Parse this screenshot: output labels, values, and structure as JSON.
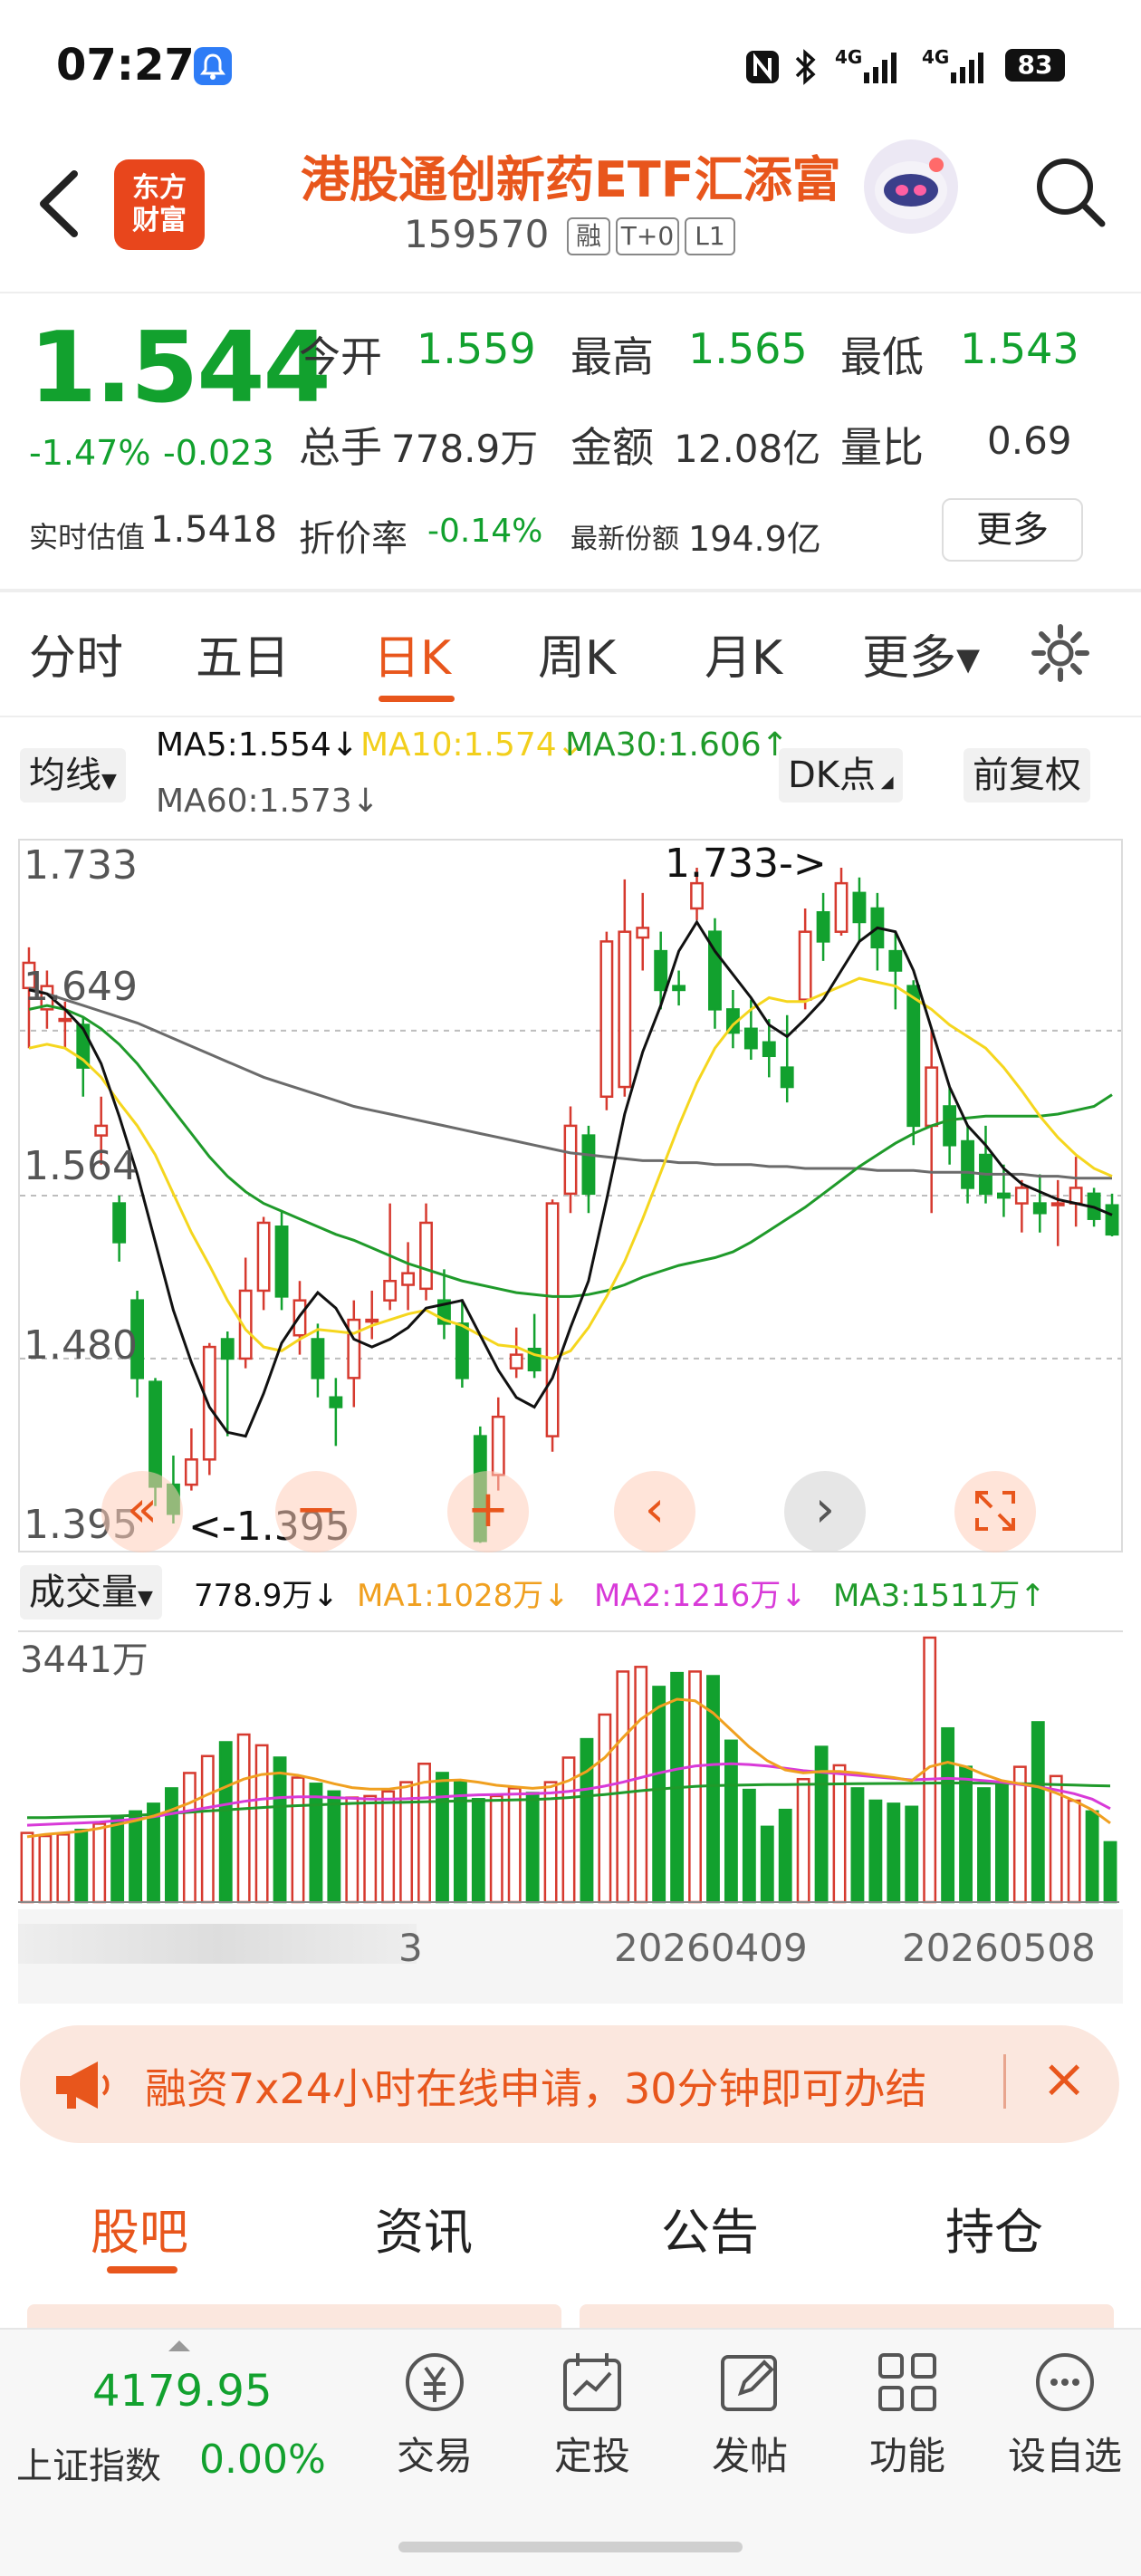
{
  "status_bar": {
    "time": "07:27",
    "network": "4G 4G",
    "battery": "83",
    "icons": [
      "bell-icon",
      "nfc-icon",
      "bluetooth-icon",
      "signal-icon"
    ]
  },
  "header": {
    "logo_text": "东方财富",
    "fund_name": "港股通创新药ETF汇添富",
    "code": "159570",
    "tags": [
      "融",
      "T+0",
      "L1"
    ]
  },
  "quote": {
    "price": "1.544",
    "change_pct": "-1.47%",
    "change": "-0.023",
    "open_label": "今开",
    "open": "1.559",
    "high_label": "最高",
    "high": "1.565",
    "low_label": "最低",
    "low": "1.543",
    "volume_label": "总手",
    "volume": "778.9万",
    "amount_label": "金额",
    "amount": "12.08亿",
    "ratio_label": "量比",
    "ratio": "0.69",
    "iopv_label": "实时估值",
    "iopv": "1.5418",
    "discount_label": "折价率",
    "discount": "-0.14%",
    "shares_label": "最新份额",
    "shares": "194.9亿",
    "more_label": "更多"
  },
  "period_tabs": {
    "items": [
      "分时",
      "五日",
      "日K",
      "周K",
      "月K",
      "更多▾"
    ],
    "active": "日K"
  },
  "ma_legend": {
    "selector": "均线",
    "ma5": "MA5:1.554↓",
    "ma10": "MA10:1.574↓",
    "ma30": "MA30:1.606↑",
    "ma60": "MA60:1.573↓",
    "dk_button": "DK点",
    "adjust_button": "前复权"
  },
  "chart_labels": {
    "y_ticks": [
      "1.733",
      "1.649",
      "1.564",
      "1.480",
      "1.395"
    ],
    "max_marker": "1.733->",
    "min_marker": "<-1.395"
  },
  "volume_legend": {
    "selector": "成交量",
    "vol": "778.9万↓",
    "ma1": "MA1:1028万↓",
    "ma2": "MA2:1216万↓",
    "ma3": "MA3:1511万↑",
    "max_label": "3441万"
  },
  "x_axis": {
    "dates": [
      "20260409",
      "20260508"
    ],
    "partial_label": "3"
  },
  "colors": {
    "up": "#d63a2f",
    "down": "#12a12e",
    "ma5": "#111111",
    "ma10": "#f5d61e",
    "ma30": "#1f9a2a",
    "ma60": "#6b6b6b",
    "vol_ma1": "#f0a020",
    "vol_ma2": "#d83ad8",
    "vol_ma3": "#1f9a2a",
    "accent": "#e8561c"
  },
  "chart_data": {
    "type": "candlestick",
    "y_range": [
      1.395,
      1.733
    ],
    "y_ticks": [
      1.733,
      1.649,
      1.564,
      1.48,
      1.395
    ],
    "candles": [
      [
        1.671,
        1.684,
        1.692,
        1.64
      ],
      [
        1.66,
        1.672,
        1.68,
        1.65
      ],
      [
        1.655,
        1.655,
        1.664,
        1.64
      ],
      [
        1.652,
        1.63,
        1.656,
        1.615
      ],
      [
        1.595,
        1.6,
        1.615,
        1.58
      ],
      [
        1.56,
        1.54,
        1.564,
        1.53
      ],
      [
        1.51,
        1.47,
        1.515,
        1.46
      ],
      [
        1.468,
        1.414,
        1.47,
        1.404
      ],
      [
        1.415,
        1.4,
        1.43,
        1.395
      ],
      [
        1.415,
        1.428,
        1.444,
        1.412
      ],
      [
        1.428,
        1.486,
        1.488,
        1.42
      ],
      [
        1.49,
        1.48,
        1.494,
        1.44
      ],
      [
        1.48,
        1.515,
        1.532,
        1.475
      ],
      [
        1.515,
        1.55,
        1.553,
        1.505
      ],
      [
        1.548,
        1.512,
        1.556,
        1.505
      ],
      [
        1.492,
        1.51,
        1.52,
        1.482
      ],
      [
        1.49,
        1.47,
        1.498,
        1.46
      ],
      [
        1.46,
        1.455,
        1.47,
        1.435
      ],
      [
        1.47,
        1.5,
        1.51,
        1.455
      ],
      [
        1.5,
        1.5,
        1.515,
        1.49
      ],
      [
        1.51,
        1.52,
        1.56,
        1.505
      ],
      [
        1.518,
        1.524,
        1.54,
        1.505
      ],
      [
        1.516,
        1.55,
        1.56,
        1.51
      ],
      [
        1.51,
        1.498,
        1.526,
        1.49
      ],
      [
        1.498,
        1.47,
        1.51,
        1.465
      ],
      [
        1.44,
        1.386,
        1.445,
        1.385
      ],
      [
        1.42,
        1.45,
        1.46,
        1.412
      ],
      [
        1.475,
        1.482,
        1.496,
        1.47
      ],
      [
        1.485,
        1.474,
        1.503,
        1.47
      ],
      [
        1.44,
        1.56,
        1.562,
        1.432
      ],
      [
        1.565,
        1.6,
        1.61,
        1.555
      ],
      [
        1.595,
        1.565,
        1.6,
        1.555
      ],
      [
        1.615,
        1.695,
        1.7,
        1.608
      ],
      [
        1.62,
        1.7,
        1.727,
        1.615
      ],
      [
        1.697,
        1.702,
        1.72,
        1.68
      ],
      [
        1.69,
        1.67,
        1.7,
        1.66
      ],
      [
        1.672,
        1.67,
        1.68,
        1.662
      ],
      [
        1.712,
        1.725,
        1.733,
        1.706
      ],
      [
        1.7,
        1.66,
        1.707,
        1.65
      ],
      [
        1.66,
        1.648,
        1.67,
        1.64
      ],
      [
        1.65,
        1.64,
        1.665,
        1.634
      ],
      [
        1.643,
        1.636,
        1.655,
        1.625
      ],
      [
        1.63,
        1.62,
        1.657,
        1.612
      ],
      [
        1.665,
        1.7,
        1.712,
        1.66
      ],
      [
        1.71,
        1.695,
        1.72,
        1.685
      ],
      [
        1.7,
        1.725,
        1.733,
        1.698
      ],
      [
        1.72,
        1.705,
        1.728,
        1.695
      ],
      [
        1.712,
        1.692,
        1.72,
        1.68
      ],
      [
        1.69,
        1.68,
        1.7,
        1.66
      ],
      [
        1.672,
        1.6,
        1.675,
        1.59
      ],
      [
        1.6,
        1.63,
        1.65,
        1.555
      ],
      [
        1.61,
        1.59,
        1.62,
        1.58
      ],
      [
        1.592,
        1.568,
        1.6,
        1.56
      ],
      [
        1.585,
        1.565,
        1.6,
        1.56
      ],
      [
        1.565,
        1.563,
        1.58,
        1.553
      ],
      [
        1.56,
        1.568,
        1.572,
        1.545
      ],
      [
        1.56,
        1.555,
        1.575,
        1.545
      ],
      [
        1.56,
        1.56,
        1.572,
        1.538
      ],
      [
        1.56,
        1.568,
        1.584,
        1.548
      ],
      [
        1.565,
        1.552,
        1.568,
        1.548
      ],
      [
        1.559,
        1.544,
        1.565,
        1.543
      ]
    ],
    "ma5": [
      1.67,
      1.668,
      1.66,
      1.65,
      1.632,
      1.605,
      1.575,
      1.54,
      1.505,
      1.478,
      1.455,
      1.442,
      1.44,
      1.462,
      1.488,
      1.502,
      1.514,
      1.506,
      1.49,
      1.486,
      1.49,
      1.496,
      1.506,
      1.508,
      1.51,
      1.492,
      1.474,
      1.46,
      1.455,
      1.47,
      1.496,
      1.52,
      1.562,
      1.606,
      1.638,
      1.662,
      1.69,
      1.705,
      1.69,
      1.678,
      1.666,
      1.652,
      1.646,
      1.655,
      1.665,
      1.68,
      1.695,
      1.702,
      1.7,
      1.68,
      1.65,
      1.62,
      1.6,
      1.59,
      1.578,
      1.57,
      1.566,
      1.562,
      1.56,
      1.558,
      1.554
    ],
    "ma10": [
      1.64,
      1.642,
      1.64,
      1.634,
      1.625,
      1.612,
      1.6,
      1.585,
      1.565,
      1.545,
      1.528,
      1.51,
      1.495,
      1.486,
      1.484,
      1.49,
      1.495,
      1.494,
      1.493,
      1.497,
      1.5,
      1.503,
      1.505,
      1.5,
      1.497,
      1.492,
      1.487,
      1.486,
      1.482,
      1.48,
      1.484,
      1.496,
      1.512,
      1.53,
      1.552,
      1.576,
      1.6,
      1.622,
      1.64,
      1.652,
      1.66,
      1.666,
      1.664,
      1.664,
      1.668,
      1.672,
      1.676,
      1.674,
      1.672,
      1.666,
      1.66,
      1.652,
      1.646,
      1.64,
      1.63,
      1.618,
      1.605,
      1.594,
      1.585,
      1.578,
      1.574
    ],
    "ma30": [
      1.66,
      1.662,
      1.66,
      1.656,
      1.65,
      1.642,
      1.632,
      1.62,
      1.608,
      1.596,
      1.584,
      1.574,
      1.566,
      1.56,
      1.556,
      1.552,
      1.548,
      1.544,
      1.541,
      1.537,
      1.533,
      1.529,
      1.526,
      1.523,
      1.52,
      1.518,
      1.516,
      1.514,
      1.513,
      1.512,
      1.512,
      1.513,
      1.515,
      1.518,
      1.522,
      1.525,
      1.528,
      1.53,
      1.532,
      1.535,
      1.54,
      1.546,
      1.552,
      1.558,
      1.565,
      1.572,
      1.579,
      1.585,
      1.591,
      1.596,
      1.6,
      1.603,
      1.604,
      1.605,
      1.605,
      1.605,
      1.605,
      1.606,
      1.608,
      1.61,
      1.616
    ],
    "ma60": [
      1.671,
      1.668,
      1.665,
      1.662,
      1.659,
      1.656,
      1.653,
      1.649,
      1.645,
      1.641,
      1.637,
      1.633,
      1.629,
      1.625,
      1.622,
      1.619,
      1.616,
      1.613,
      1.61,
      1.608,
      1.606,
      1.604,
      1.602,
      1.6,
      1.598,
      1.596,
      1.594,
      1.592,
      1.59,
      1.588,
      1.586,
      1.585,
      1.584,
      1.583,
      1.582,
      1.582,
      1.581,
      1.581,
      1.58,
      1.58,
      1.58,
      1.579,
      1.579,
      1.578,
      1.578,
      1.578,
      1.578,
      1.577,
      1.577,
      1.577,
      1.576,
      1.576,
      1.576,
      1.575,
      1.575,
      1.575,
      1.574,
      1.574,
      1.573,
      1.573,
      1.573
    ],
    "volume_max": 3441,
    "volume_unit": "万",
    "volumes": [
      900,
      860,
      880,
      940,
      1020,
      1120,
      1180,
      1280,
      1480,
      1680,
      1900,
      2080,
      2180,
      2040,
      1880,
      1620,
      1540,
      1440,
      1360,
      1380,
      1440,
      1560,
      1800,
      1680,
      1560,
      1340,
      1380,
      1480,
      1420,
      1560,
      1880,
      2120,
      2440,
      3000,
      3060,
      2800,
      2980,
      3000,
      2940,
      2100,
      1460,
      980,
      1200,
      1600,
      2020,
      1780,
      1480,
      1320,
      1280,
      1240,
      3441,
      2260,
      1760,
      1480,
      1520,
      1760,
      2340,
      1640,
      1320,
      1180,
      779
    ],
    "vol_ma1": [
      850,
      880,
      900,
      920,
      960,
      1010,
      1060,
      1120,
      1200,
      1290,
      1400,
      1500,
      1600,
      1660,
      1680,
      1650,
      1600,
      1540,
      1490,
      1470,
      1470,
      1500,
      1560,
      1580,
      1590,
      1560,
      1520,
      1500,
      1480,
      1500,
      1580,
      1700,
      1880,
      2140,
      2380,
      2540,
      2640,
      2620,
      2460,
      2240,
      2020,
      1840,
      1720,
      1680,
      1700,
      1700,
      1680,
      1650,
      1620,
      1580,
      1760,
      1820,
      1760,
      1660,
      1580,
      1540,
      1500,
      1420,
      1320,
      1200,
      1028
    ],
    "vol_ma2": [
      1000,
      1010,
      1020,
      1030,
      1040,
      1060,
      1080,
      1110,
      1150,
      1190,
      1230,
      1270,
      1310,
      1340,
      1360,
      1370,
      1370,
      1360,
      1350,
      1340,
      1340,
      1345,
      1355,
      1370,
      1385,
      1395,
      1400,
      1405,
      1410,
      1420,
      1440,
      1470,
      1510,
      1560,
      1620,
      1680,
      1730,
      1770,
      1790,
      1800,
      1790,
      1770,
      1740,
      1710,
      1690,
      1670,
      1650,
      1630,
      1610,
      1590,
      1600,
      1610,
      1600,
      1580,
      1560,
      1530,
      1500,
      1460,
      1410,
      1340,
      1216
    ],
    "vol_ma3": [
      1100,
      1100,
      1105,
      1110,
      1115,
      1120,
      1130,
      1140,
      1155,
      1170,
      1185,
      1200,
      1215,
      1230,
      1245,
      1255,
      1265,
      1275,
      1285,
      1290,
      1295,
      1300,
      1305,
      1310,
      1315,
      1320,
      1325,
      1330,
      1335,
      1345,
      1360,
      1380,
      1400,
      1425,
      1450,
      1470,
      1490,
      1505,
      1515,
      1520,
      1525,
      1528,
      1530,
      1532,
      1535,
      1538,
      1540,
      1542,
      1544,
      1545,
      1548,
      1550,
      1550,
      1548,
      1545,
      1540,
      1535,
      1528,
      1522,
      1516,
      1511
    ]
  },
  "promo": {
    "text": "融资7x24小时在线申请，30分钟即可办结",
    "close": "×"
  },
  "content_tabs": {
    "items": [
      "股吧",
      "资讯",
      "公告",
      "持仓"
    ],
    "active": "股吧"
  },
  "bottom_nav": {
    "index_value": "4179.95",
    "index_name": "上证指数",
    "index_change": "0.00%",
    "items": [
      {
        "label": "交易",
        "icon": "trade-icon"
      },
      {
        "label": "定投",
        "icon": "invest-icon"
      },
      {
        "label": "发帖",
        "icon": "post-icon"
      },
      {
        "label": "功能",
        "icon": "function-icon"
      },
      {
        "label": "设自选",
        "icon": "favorite-icon"
      }
    ]
  }
}
